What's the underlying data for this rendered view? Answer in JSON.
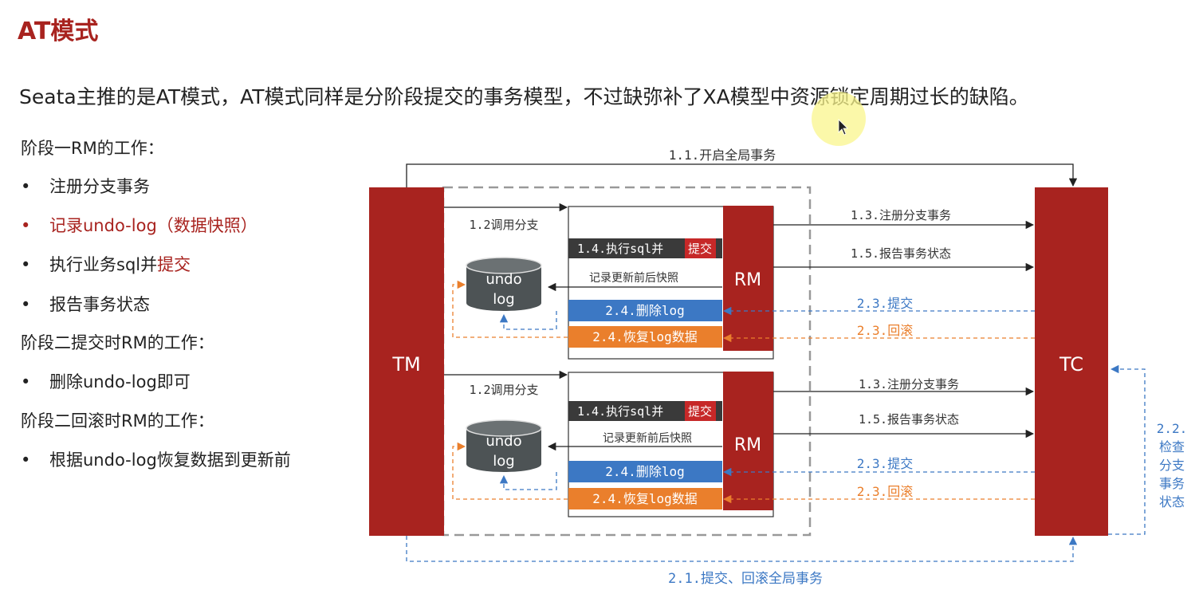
{
  "title": "AT模式",
  "intro": "Seata主推的是AT模式，AT模式同样是分阶段提交的事务模型，不过缺弥补了XA模型中资源锁定周期过长的缺陷。",
  "left": {
    "phase1_heading": "阶段一RM的工作：",
    "phase1_items": [
      "注册分支事务",
      "记录undo-log（数据快照）",
      "执行业务sql并",
      "提交",
      "报告事务状态"
    ],
    "phase2_commit_heading": "阶段二提交时RM的工作：",
    "phase2_commit_items": [
      "删除undo-log即可"
    ],
    "phase2_rollback_heading": "阶段二回滚时RM的工作：",
    "phase2_rollback_items": [
      "根据undo-log恢复数据到更新前"
    ],
    "bullet": "•"
  },
  "diagram": {
    "tm": "TM",
    "tc": "TC",
    "rm": "RM",
    "start_global": "1.1.开启全局事务",
    "call_branch": "1.2调用分支",
    "exec_sql": "1.4.执行sql并",
    "commit_word": "提交",
    "record_snapshot": "记录更新前后快照",
    "delete_log": "2.4.删除log",
    "restore_log": "2.4.恢复log数据",
    "register_branch": "1.3.注册分支事务",
    "report_status": "1.5.报告事务状态",
    "commit": "2.3.提交",
    "rollback": "2.3.回滚",
    "undo_line1": "undo",
    "undo_line2": "log",
    "check_status_lines": [
      "2.2.",
      "检查",
      "分支",
      "事务",
      "状态"
    ],
    "global_commit_rollback": "2.1.提交、回滚全局事务"
  },
  "colors": {
    "dark_red": "#a8231f",
    "blue": "#3c78c4",
    "orange": "#ea7f2c",
    "dark_bar": "#3a3a3a",
    "db_gray": "#4d5355"
  }
}
